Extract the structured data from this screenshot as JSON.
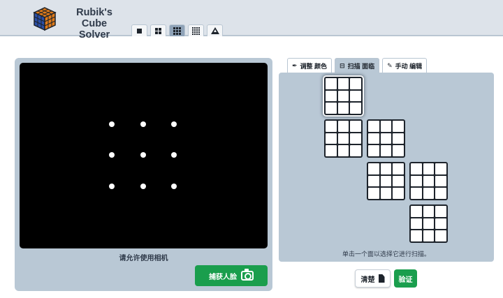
{
  "header": {
    "title_line1": "Rubik's Cube",
    "title_line2": "Solver",
    "cube_tabs": [
      {
        "icon": "1x1-grid-icon",
        "selected": false
      },
      {
        "icon": "2x2-grid-icon",
        "selected": false
      },
      {
        "icon": "3x3-grid-icon",
        "selected": true
      },
      {
        "icon": "4x4-grid-icon",
        "selected": false
      },
      {
        "icon": "pyraminx-icon",
        "selected": false
      }
    ]
  },
  "camera_panel": {
    "message": "请允许使用相机",
    "capture_label": "捕获人脸"
  },
  "mode_tabs": [
    {
      "label": "调整 颜色",
      "icon": "eyedropper-icon",
      "active": false
    },
    {
      "label": "扫描 面临",
      "icon": "scan-icon",
      "active": true
    },
    {
      "label": "手动 编辑",
      "icon": "pencil-icon",
      "active": false
    }
  ],
  "scan_panel": {
    "hint": "单击一个面以选择它进行扫描。",
    "selected_face": 1
  },
  "actions": {
    "clear_label": "清楚",
    "verify_label": "验证"
  },
  "colors": {
    "header_bg": "#dde3ea",
    "panel_bg": "#b9c8d5",
    "accent_green": "#1a9e4d",
    "active_tab": "#8fa3b8"
  }
}
